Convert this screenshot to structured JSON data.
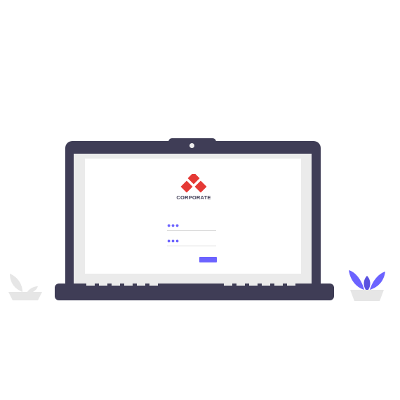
{
  "colors": {
    "laptop_frame": "#3f3d56",
    "screen_bezel": "#ebebeb",
    "screen": "#ffffff",
    "logo_red": "#e53935",
    "accent": "#6c63ff",
    "plant_gray": "#e6e6e6",
    "plant_leaf": "#6c63ff"
  },
  "login": {
    "logo_text": "CORPORATE",
    "username_value": "●●●",
    "password_value": "●●●"
  },
  "icons": {
    "logo": "diamond-logo-icon",
    "webcam": "webcam-icon",
    "left_plant": "plant-gray-icon",
    "right_plant": "plant-purple-icon"
  }
}
